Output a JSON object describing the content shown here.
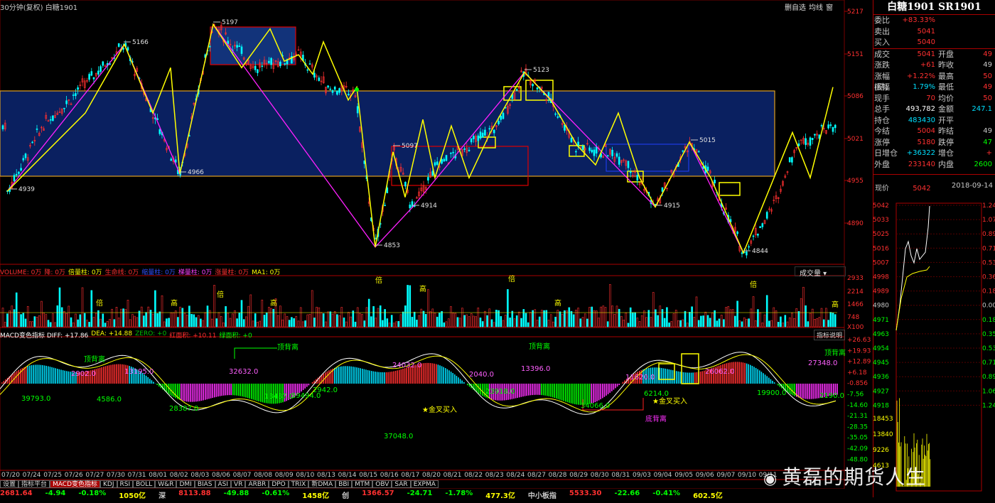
{
  "header": {
    "title": "30分钟(复权)  白糖1901",
    "buttons": [
      "删自选",
      "均线",
      "窗"
    ]
  },
  "price_axis": [
    "5217",
    "5151",
    "5086",
    "5021",
    "4955",
    "4890"
  ],
  "price_labels": [
    "5197",
    "5166",
    "5123",
    "5097",
    "5015",
    "4966",
    "4939",
    "4915",
    "4914",
    "4853",
    "4844"
  ],
  "volume": {
    "indicator_line": [
      {
        "t": "VOLUME: 0万",
        "c": "#ff3030"
      },
      {
        "t": "降: 0万",
        "c": "#ff3030"
      },
      {
        "t": "倍量柱: 0万",
        "c": "#ffff00"
      },
      {
        "t": "生命线: 0万",
        "c": "#ff3030"
      },
      {
        "t": "缩量柱: 0万",
        "c": "#3050ff"
      },
      {
        "t": "梯量柱: 0万",
        "c": "#ff40ff"
      },
      {
        "t": "涨量柱: 0万",
        "c": "#ff3030"
      },
      {
        "t": "MA1: 0万",
        "c": "#ffff00"
      }
    ],
    "mode": "成交量",
    "axis": [
      "2933",
      "2214",
      "1466",
      "748",
      "X100"
    ],
    "labels": [
      "高",
      "倍"
    ]
  },
  "macd": {
    "indicator_line": [
      {
        "t": "MACD变色指标 DIFF: +17.86",
        "c": "#ffffff"
      },
      {
        "t": "DEA: +14.88",
        "c": "#ffff00"
      },
      {
        "t": "ZERO: +0",
        "c": "#00c000"
      },
      {
        "t": "红面积: +10.11",
        "c": "#ff3030"
      },
      {
        "t": "绿面积: +0",
        "c": "#00ff00"
      }
    ],
    "button": "指标说明",
    "axis": [
      "+26.63",
      "+19.93",
      "+12.89",
      "+6.18",
      "-0.856",
      "-7.56",
      "-14.60",
      "-21.31",
      "-28.35",
      "-35.05",
      "-42.09",
      "-48.80"
    ],
    "annotations": [
      "顶背离",
      "顶背离",
      "顶背离",
      "顶背离",
      "底背离",
      "金叉买入",
      "金叉买入"
    ],
    "values_magenta": [
      "2902.0",
      "13195.0",
      "32632.0",
      "24032.0",
      "2040.0",
      "13396.0",
      "11620.0",
      "26062.0",
      "27348.0"
    ],
    "values_green": [
      "39793.0",
      "4586.0",
      "28387.0",
      "13487.0",
      "39494.0",
      "2942.0",
      "37048.0",
      "23918.0",
      "34066.0",
      "6214.0",
      "19900.0",
      "2190.0"
    ]
  },
  "dates": [
    "07/20",
    "07/24",
    "07/25",
    "07/26",
    "07/27",
    "07/30",
    "07/31",
    "08/01",
    "08/02",
    "08/03",
    "08/06",
    "08/07",
    "08/08",
    "08/09",
    "08/10",
    "08/13",
    "08/14",
    "08/15",
    "08/16",
    "08/17",
    "08/20",
    "08/21",
    "08/22",
    "08/23",
    "08/24",
    "08/27",
    "08/28",
    "08/29",
    "08/30",
    "08/31",
    "09/03",
    "09/04",
    "09/05",
    "09/06",
    "09/07",
    "09/10",
    "09/11"
  ],
  "tabs": [
    "设置",
    "指标平台",
    "MACD变色指标",
    "KDJ",
    "RSI",
    "BOLL",
    "W&R",
    "DMI",
    "BIAS",
    "ASI",
    "VR",
    "ARBR",
    "DPO",
    "TRIX",
    "新DMA",
    "BBI",
    "MTM",
    "OBV",
    "SAR",
    "EXPMA"
  ],
  "ticker": [
    {
      "t": "2681.64",
      "c": "#ff3030"
    },
    {
      "t": "-4.94",
      "c": "#00ff00"
    },
    {
      "t": "-0.18%",
      "c": "#00ff00"
    },
    {
      "t": "1050亿",
      "c": "#ffff00"
    },
    {
      "t": "深",
      "c": "#c8c8c8"
    },
    {
      "t": "8113.88",
      "c": "#ff3030"
    },
    {
      "t": "-49.88",
      "c": "#00ff00"
    },
    {
      "t": "-0.61%",
      "c": "#00ff00"
    },
    {
      "t": "1458亿",
      "c": "#ffff00"
    },
    {
      "t": "创",
      "c": "#c8c8c8"
    },
    {
      "t": "1366.57",
      "c": "#ff3030"
    },
    {
      "t": "-24.71",
      "c": "#00ff00"
    },
    {
      "t": "-1.78%",
      "c": "#00ff00"
    },
    {
      "t": "477.3亿",
      "c": "#ffff00"
    },
    {
      "t": "中小板指",
      "c": "#c8c8c8"
    },
    {
      "t": "5533.30",
      "c": "#ff3030"
    },
    {
      "t": "-22.66",
      "c": "#00ff00"
    },
    {
      "t": "-0.41%",
      "c": "#00ff00"
    },
    {
      "t": "602.5亿",
      "c": "#ffff00"
    }
  ],
  "quote": {
    "title": "白糖1901 SR1901",
    "rows": [
      {
        "k": "委比",
        "v": "+83.33%",
        "vc": "#ff3030"
      },
      {
        "k": "卖出",
        "v": "5041",
        "vc": "#ff3030"
      },
      {
        "k": "买入",
        "v": "5040",
        "vc": "#ff3030"
      }
    ],
    "rows2": [
      {
        "k": "成交",
        "v": "5041",
        "vc": "#ff3030",
        "k2": "开盘",
        "v2": "49",
        "v2c": "#ff3030"
      },
      {
        "k": "涨跌",
        "v": "+61",
        "vc": "#ff3030",
        "k2": "昨收",
        "v2": "49",
        "v2c": "#c8c8c8"
      },
      {
        "k": "涨幅(结)",
        "v": "+1.22%",
        "vc": "#ff3030",
        "k2": "最高",
        "v2": "50",
        "v2c": "#ff3030"
      },
      {
        "k": "振幅",
        "v": "1.79%",
        "vc": "#00e0ff",
        "k2": "最低",
        "v2": "49",
        "v2c": "#ff3030"
      },
      {
        "k": "现手",
        "v": "70",
        "vc": "#ff3030",
        "k2": "均价",
        "v2": "50",
        "v2c": "#ff3030"
      },
      {
        "k": "总手",
        "v": "493,782",
        "vc": "#ffffff",
        "k2": "金额",
        "v2": "247.1",
        "v2c": "#00e0ff"
      },
      {
        "k": "持仓",
        "v": "483430",
        "vc": "#00e0ff",
        "k2": "开平",
        "v2": "",
        "v2c": "#c8c8c8"
      },
      {
        "k": "今结",
        "v": "5004",
        "vc": "#ff3030",
        "k2": "昨结",
        "v2": "49",
        "v2c": "#c8c8c8"
      },
      {
        "k": "涨停",
        "v": "5180",
        "vc": "#ff3030",
        "k2": "跌停",
        "v2": "47",
        "v2c": "#00ff00"
      },
      {
        "k": "日增仓",
        "v": "+36322",
        "vc": "#00e0ff",
        "k2": "增仓",
        "v2": "+",
        "v2c": "#ff3030"
      },
      {
        "k": "外盘",
        "v": "233140",
        "vc": "#ff3030",
        "k2": "内盘",
        "v2": "2600",
        "v2c": "#00ff00"
      }
    ],
    "now_label": "现价",
    "now_value": "5042",
    "now_date": "2018-09-14",
    "mini_left_axis": [
      "5042",
      "5033",
      "5025",
      "5016",
      "5007",
      "4998",
      "4989",
      "4980",
      "4971",
      "4963",
      "4954",
      "4945",
      "4936",
      "4927",
      "4918"
    ],
    "mini_right_axis": [
      "1.24",
      "1.07",
      "0.89",
      "0.71",
      "0.53",
      "0.36",
      "0.18",
      "0.00",
      "0.18",
      "0.35",
      "0.53",
      "0.71",
      "0.89",
      "1.06",
      "1.24"
    ],
    "mini_vol_axis": [
      "18453",
      "13840",
      "9226",
      "4613"
    ]
  },
  "watermark": "黄磊的期货人生",
  "colors": {
    "up": "#ff3030",
    "down": "#00ffff",
    "zig": "#ff20ff",
    "wave": "#ffff00",
    "zone": "#0a2060",
    "zone_border": "#e0a020",
    "grid_red": "#aa0000"
  }
}
